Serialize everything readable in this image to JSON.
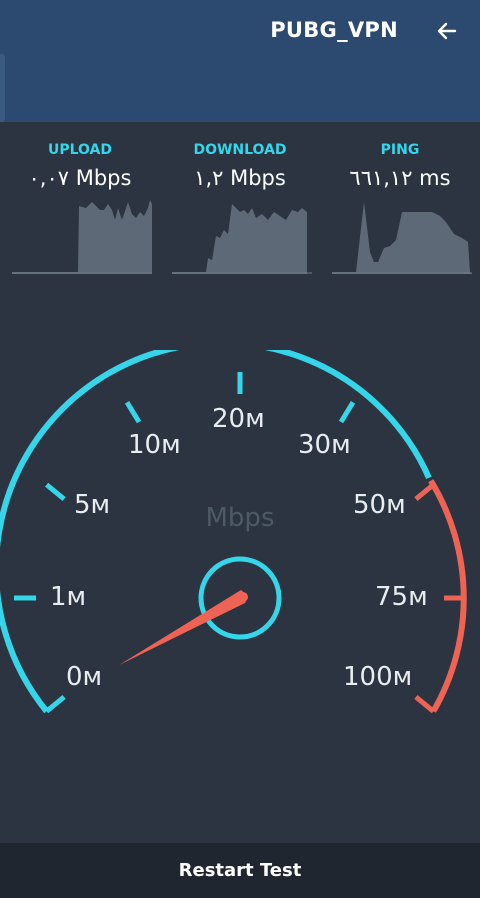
{
  "header": {
    "title": "PUBG_VPN",
    "back_icon": "arrow-left-icon"
  },
  "stats": {
    "upload": {
      "label": "UPLOAD",
      "value": "٠,٠٧ Mbps"
    },
    "download": {
      "label": "DOWNLOAD",
      "value": "١,٢ Mbps"
    },
    "ping": {
      "label": "PING",
      "value": "٦٦١,١٢ ms"
    }
  },
  "gauge": {
    "unit": "Mbps",
    "ticks": [
      "0м",
      "1м",
      "5м",
      "10м",
      "20м",
      "30м",
      "50м",
      "75м",
      "100м"
    ],
    "needle_value": "0м",
    "colors": {
      "normal": "#35d6ea",
      "high": "#ef6355",
      "needle": "#ef6355"
    }
  },
  "footer": {
    "restart_label": "Restart Test"
  }
}
